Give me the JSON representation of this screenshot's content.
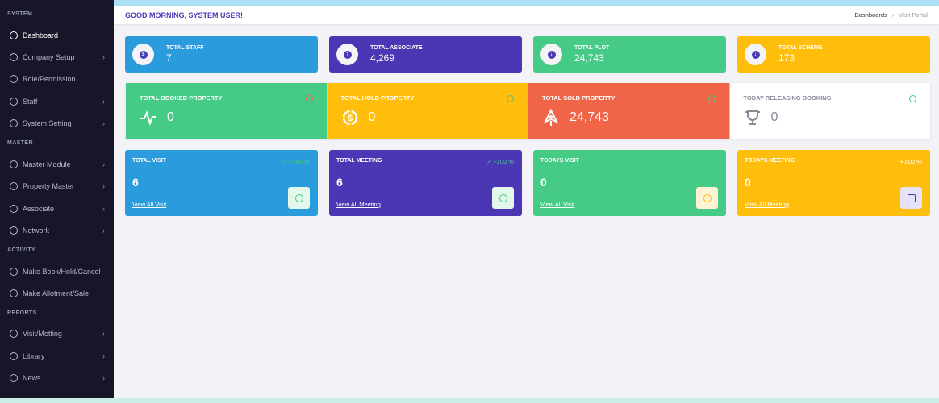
{
  "sidebar": {
    "sections": [
      {
        "title": "SYSTEM",
        "items": [
          {
            "label": "Dashboard",
            "icon": "gauge-icon",
            "active": true
          },
          {
            "label": "Company Setup",
            "icon": "user-circle-icon",
            "chevron": true
          },
          {
            "label": "Role/Permission",
            "icon": "user-minus-icon"
          },
          {
            "label": "Staff",
            "icon": "user-icon",
            "chevron": true
          },
          {
            "label": "System Setting",
            "icon": "layers-icon",
            "chevron": true
          }
        ]
      },
      {
        "title": "MASTER",
        "items": [
          {
            "label": "Master Module",
            "icon": "user-circle-icon",
            "chevron": true
          },
          {
            "label": "Property Master",
            "icon": "layers-icon",
            "chevron": true
          },
          {
            "label": "Associate",
            "icon": "layers-icon",
            "chevron": true
          },
          {
            "label": "Network",
            "icon": "steering-icon",
            "chevron": true
          }
        ]
      },
      {
        "title": "ACTIVITY",
        "items": [
          {
            "label": "Make Book/Hold/Cancel",
            "icon": "circle-icon"
          },
          {
            "label": "Make Allotment/Sale",
            "icon": "compass-icon"
          }
        ]
      },
      {
        "title": "REPORTS",
        "items": [
          {
            "label": "Visit/Metting",
            "icon": "steering-icon",
            "chevron": true
          },
          {
            "label": "Library",
            "icon": "compass-icon",
            "chevron": true
          },
          {
            "label": "News",
            "icon": "circle-icon",
            "chevron": true
          }
        ]
      }
    ]
  },
  "header": {
    "greeting": "GOOD MORNING, SYSTEM USER!",
    "breadcrumb": [
      "Dashboards",
      "Visit Portal"
    ],
    "separator": "›"
  },
  "summary": [
    {
      "title": "TOTAL STAFF",
      "value": "7",
      "color": "#2a9bdc",
      "glyph": "$"
    },
    {
      "title": "TOTAL ASSOCIATE",
      "value": "4,269",
      "color": "#4b37b3",
      "glyph": "↑"
    },
    {
      "title": "TOTAL PLOT",
      "value": "24,743",
      "color": "#45cb85",
      "glyph": "↓"
    },
    {
      "title": "TOTAL SCHEME",
      "value": "173",
      "color": "#ffbe0b",
      "glyph": "↓"
    }
  ],
  "property": [
    {
      "title": "TOTAL BOOKED PROPERTY",
      "value": "0",
      "color": "#45cb85",
      "icon": "activity-icon",
      "trend": "down"
    },
    {
      "title": "TOTAL HOLD PROPERTY",
      "value": "0",
      "color": "#ffbe0b",
      "icon": "dollar-refresh-icon",
      "trend": "up"
    },
    {
      "title": "TOTAL SOLD PROPERTY",
      "value": "24,743",
      "color": "#f06548",
      "icon": "rocket-icon",
      "trend": "up"
    },
    {
      "title": "TODAY RELEASING BOOKING",
      "value": "0",
      "color": "#ffffff",
      "icon": "trophy-icon",
      "trend": "up"
    }
  ],
  "visits": [
    {
      "title": "TOTAL VISIT",
      "value": "6",
      "change": "↗ +100 %",
      "link": "View All Visit",
      "color": "#2a9bdc",
      "icon": "dollar-icon"
    },
    {
      "title": "TOTAL MEETING",
      "value": "6",
      "change": "↗ +100 %",
      "link": "View All Meeting",
      "color": "#4b37b3",
      "icon": "shopping-bag-icon"
    },
    {
      "title": "TODAYS VISIT",
      "value": "0",
      "change": "",
      "link": "View All Visit",
      "color": "#45cb85",
      "icon": "user-circle-icon"
    },
    {
      "title": "TODAYS MEETING",
      "value": "0",
      "change": "+0.00 %",
      "link": "View All Meeting",
      "color": "#ffbe0b",
      "icon": "wallet-icon"
    }
  ]
}
